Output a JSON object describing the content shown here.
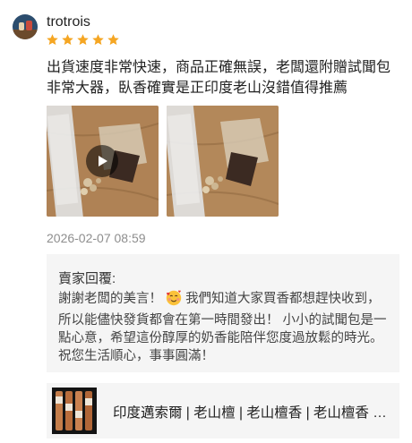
{
  "review": {
    "username": "trotrois",
    "rating": 5,
    "text_line1": "出貨速度非常快速，商品正確無誤，老闆還附贈試聞包",
    "text_line2": "非常大器，臥香確實是正印度老山沒錯值得推薦",
    "media": [
      {
        "type": "video",
        "icon": "play-icon"
      },
      {
        "type": "image"
      }
    ],
    "timestamp": "2026-02-07 08:59"
  },
  "seller_reply": {
    "label": "賣家回覆:",
    "text_part1": "謝謝老闆的美言！",
    "emoji": "smiling-face-with-hearts",
    "text_part2": "我們知道大家買香都想趕快收到，所以能儘快發貨都會在第一時間發出！ 小小的試聞包是一點心意，希望這份醇厚的奶香能陪伴您度過放鬆的時光。祝您生活順心，事事圓滿！"
  },
  "product": {
    "title": "印度邁索爾 | 老山檀 | 老山檀香 | 老山檀香 精選 臥香"
  },
  "colors": {
    "star": "#f5a623",
    "reply_bg": "#f5f5f5",
    "timestamp": "#8e8e8e"
  }
}
